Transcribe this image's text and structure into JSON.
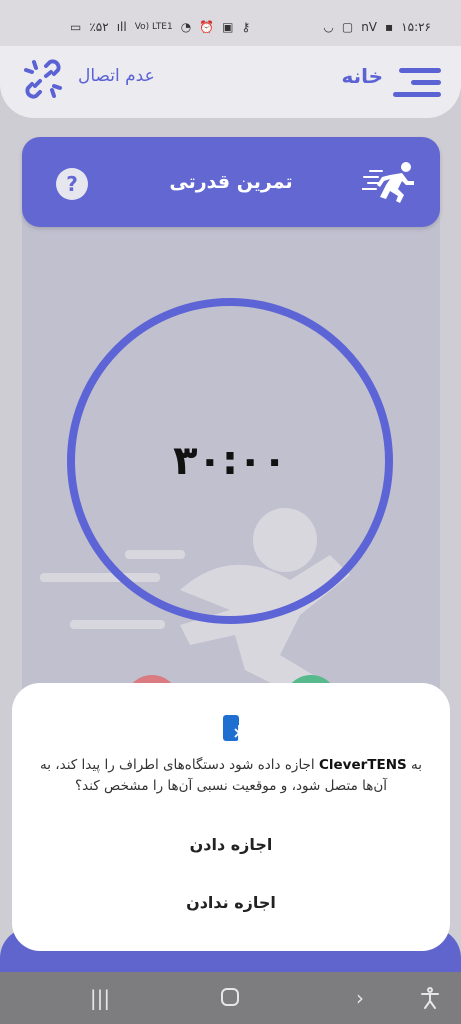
{
  "status_bar": {
    "battery": "٪۵۲",
    "time": "۱۵:۲۶",
    "net_label": "nV",
    "volte": "Vo) LTE1"
  },
  "app_bar": {
    "home_label": "خانه",
    "connection_label": "عدم اتصال"
  },
  "header": {
    "title": "تمرین قدرتی",
    "help": "?"
  },
  "timer": {
    "display": "۳۰:۰۰"
  },
  "dialog": {
    "message_prefix": "به ",
    "app_name": "CleverTENS",
    "message_rest": " اجازه داده شود دستگاه‌های اطراف را پیدا کند، به آن‌ها متصل شود، و موقعیت نسبی آن‌ها را مشخص کند؟",
    "allow": "اجازه دادن",
    "deny": "اجازه ندادن"
  },
  "colors": {
    "primary": "#6267d2",
    "ring": "#5d64d6",
    "card_bg": "#c1c0cf",
    "dialog_bg": "#ffffff"
  }
}
